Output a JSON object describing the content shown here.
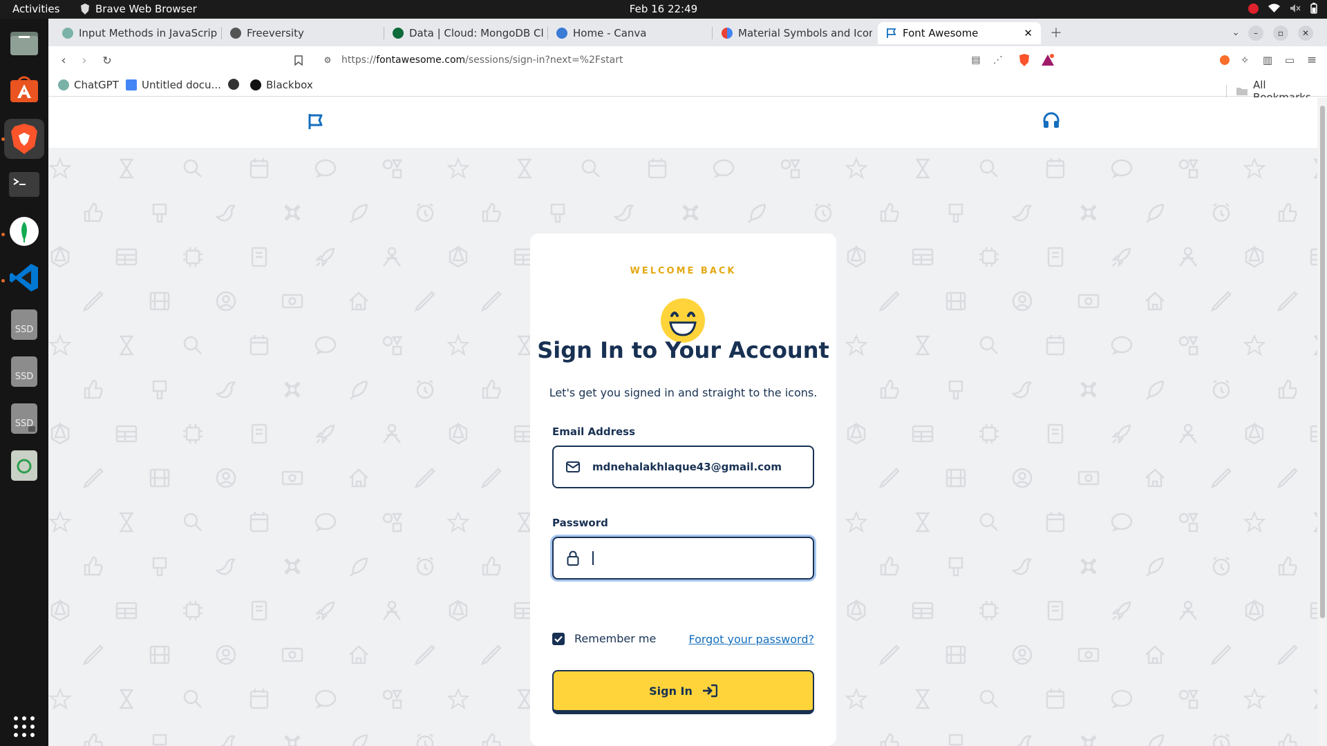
{
  "os": {
    "activities": "Activities",
    "app_name": "Brave Web Browser",
    "clock": "Feb 16  22:49"
  },
  "dock": {
    "items": [
      "files-icon",
      "app-center-icon",
      "brave-icon",
      "terminal-icon",
      "mongodb-compass-icon",
      "vscode-icon",
      "ssd-drive-icon",
      "ssd-drive-icon",
      "ssd-drive-icon",
      "trash-icon",
      "show-apps-icon"
    ],
    "ssd_label": "SSD"
  },
  "browser": {
    "tabs": [
      {
        "label": "Input Methods in JavaScript",
        "favicon_color": "#7bb2a8"
      },
      {
        "label": "Freeversity",
        "favicon_color": "#555555"
      },
      {
        "label": "Data | Cloud: MongoDB Clou",
        "favicon_color": "#0e6b3a"
      },
      {
        "label": "Home - Canva",
        "favicon_color": "#3a7bd5"
      },
      {
        "label": "Material Symbols and Icons -",
        "favicon_color": "#ea4335"
      },
      {
        "label": "Font Awesome",
        "favicon_color": "#146ebe"
      }
    ],
    "url_prefix": "https://",
    "url_host": "fontawesome.com",
    "url_path": "/sessions/sign-in?next=%2Fstart",
    "bookmarks": [
      "ChatGPT",
      "Untitled docu...",
      "",
      "Blackbox"
    ],
    "all_bookmarks": "All Bookmarks"
  },
  "signin_card": {
    "eyebrow": "WELCOME BACK",
    "title": "Sign In to Your Account",
    "subtitle": "Let's get you signed in and straight to the icons.",
    "email_label": "Email Address",
    "email_value": "mdnehalakhlaque43@gmail.com",
    "password_label": "Password",
    "password_value": "",
    "remember_label": "Remember me",
    "remember_checked": true,
    "forgot_label": "Forgot your password?",
    "signin_label": "Sign In"
  },
  "colors": {
    "navy": "#183153",
    "yellow": "#ffd43b",
    "eyebrow": "#e4a812",
    "link": "#146ebe"
  }
}
